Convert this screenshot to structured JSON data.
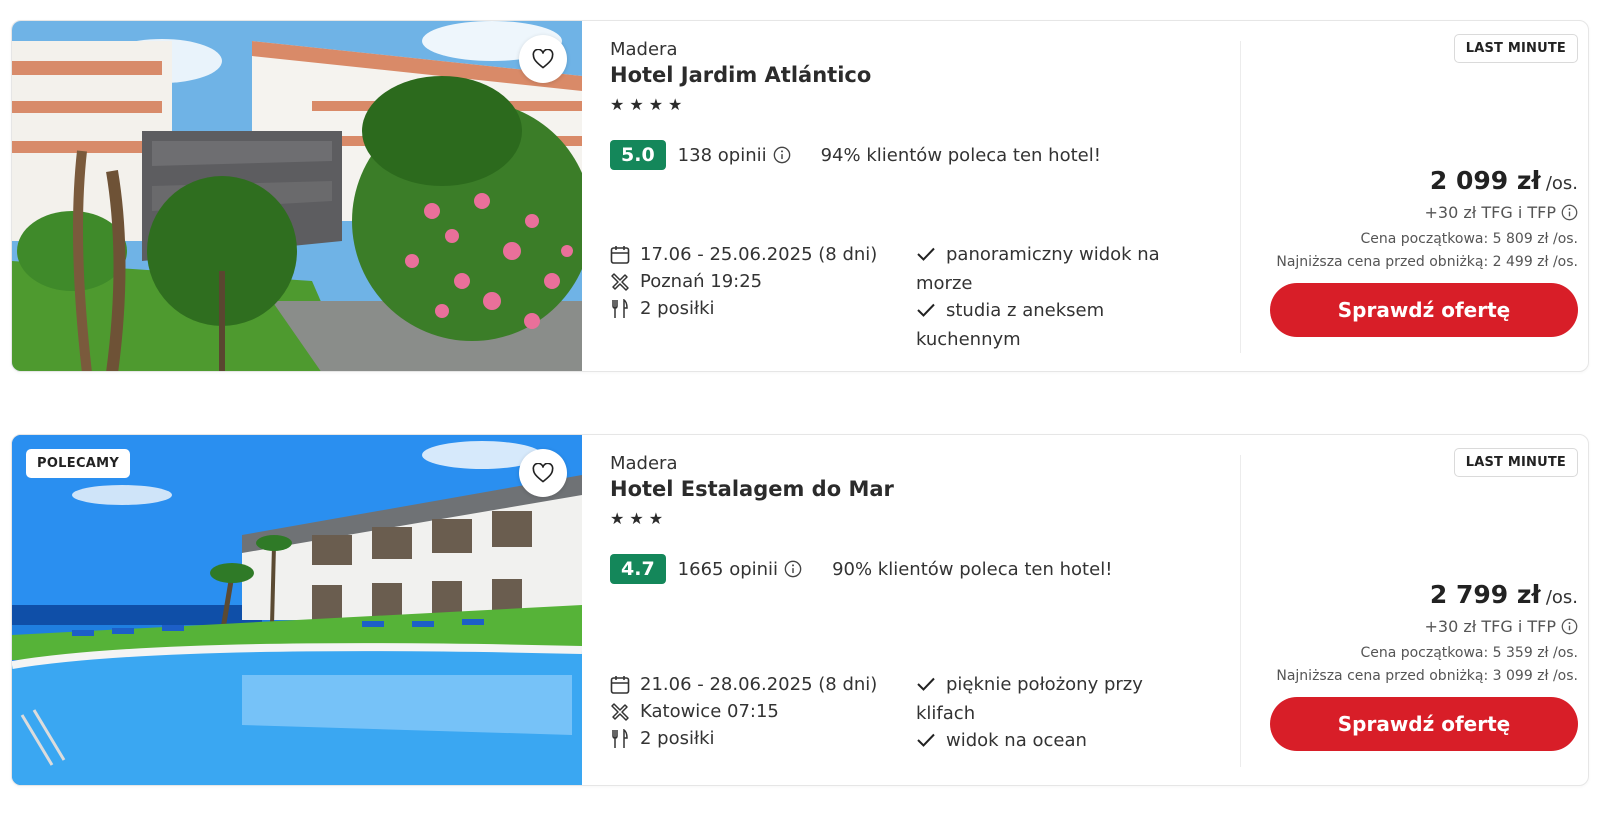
{
  "offers": [
    {
      "region": "Madera",
      "hotel_name": "Hotel Jardim Atlántico",
      "stars": 4,
      "stars_text": "★★★★",
      "badge": null,
      "score": "5.0",
      "reviews": "138 opinii",
      "recommend": "94% klientów poleca ten hotel!",
      "dates": "17.06 - 25.06.2025 (8 dni)",
      "departure": "Poznań 19:25",
      "meals": "2 posiłki",
      "features": [
        "panoramiczny widok na morze",
        "studia z aneksem kuchennym"
      ],
      "tag": "LAST MINUTE",
      "price": "2 099 zł",
      "per_person": "/os.",
      "fee": "+30 zł TFG i TFP",
      "start_price": "Cena początkowa: 5 809 zł /os.",
      "lowest_price": "Najniższa cena przed obniżką: 2 499 zł /os.",
      "cta": "Sprawdź ofertę"
    },
    {
      "region": "Madera",
      "hotel_name": "Hotel Estalagem do Mar",
      "stars": 3,
      "stars_text": "★★★",
      "badge": "POLECAMY",
      "score": "4.7",
      "reviews": "1665 opinii",
      "recommend": "90% klientów poleca ten hotel!",
      "dates": "21.06 - 28.06.2025 (8 dni)",
      "departure": "Katowice 07:15",
      "meals": "2 posiłki",
      "features": [
        "pięknie położony przy klifach",
        "widok na ocean"
      ],
      "tag": "LAST MINUTE",
      "price": "2 799 zł",
      "per_person": "/os.",
      "fee": "+30 zł TFG i TFP",
      "start_price": "Cena początkowa: 5 359 zł /os.",
      "lowest_price": "Najniższa cena przed obniżką: 3 099 zł /os.",
      "cta": "Sprawdź ofertę"
    }
  ],
  "icons": {
    "favorite": "heart-outline-icon",
    "info": "info-circle-icon",
    "calendar": "calendar-icon",
    "flight": "plane-icon",
    "meals": "fork-knife-icon",
    "check": "checkmark-icon"
  },
  "colors": {
    "score_bg": "#14875a",
    "cta_bg": "#d81e28",
    "text": "#2b2b2b"
  }
}
